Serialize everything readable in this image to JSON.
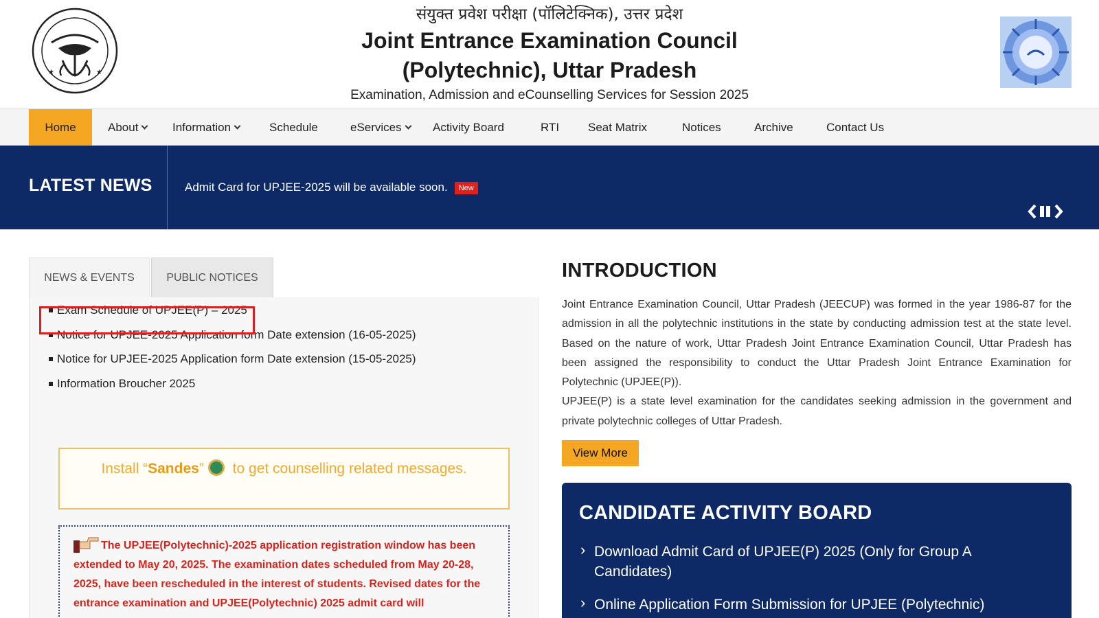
{
  "header": {
    "hindi_title": "संयुक्त प्रवेश परीक्षा (पॉलिटेक्निक), उत्तर प्रदेश",
    "title_line1": "Joint Entrance Examination Council",
    "title_line2": "(Polytechnic), Uttar Pradesh",
    "session": "Examination, Admission and eCounselling Services for Session 2025",
    "left_emblem": "uttar-pradesh-government-seal",
    "right_emblem": "jeec-parishad-logo"
  },
  "nav": {
    "items": [
      {
        "label": "Home",
        "active": true,
        "dropdown": false
      },
      {
        "label": "About",
        "active": false,
        "dropdown": true
      },
      {
        "label": "Information",
        "active": false,
        "dropdown": true
      },
      {
        "label": "Schedule",
        "active": false,
        "dropdown": false
      },
      {
        "label": "eServices",
        "active": false,
        "dropdown": true
      },
      {
        "label": "Activity Board",
        "active": false,
        "dropdown": false
      },
      {
        "label": "RTI",
        "active": false,
        "dropdown": false
      },
      {
        "label": "Seat Matrix",
        "active": false,
        "dropdown": false
      },
      {
        "label": "Notices",
        "active": false,
        "dropdown": false
      },
      {
        "label": "Archive",
        "active": false,
        "dropdown": false
      },
      {
        "label": "Contact Us",
        "active": false,
        "dropdown": false
      }
    ]
  },
  "latest_news": {
    "label": "LATEST NEWS",
    "text": "Admit Card for UPJEE-2025 will be available soon.",
    "badge": "New",
    "controls": [
      "chevron-left-icon",
      "pause-icon",
      "chevron-right-icon"
    ]
  },
  "tabs": {
    "news_events": "NEWS & EVENTS",
    "public_notices": "PUBLIC NOTICES"
  },
  "news_list": [
    "Exam Schedule of UPJEE(P) – 2025",
    "Notice for UPJEE-2025 Application form Date extension (16-05-2025)",
    "Notice for UPJEE-2025 Application form Date extension (15-05-2025)",
    "Information Broucher 2025"
  ],
  "sandes": {
    "prefix": "Install “",
    "app": "Sandes",
    "suffix_quote": "”",
    "rest": " to get counselling related messages."
  },
  "notice": {
    "text": "The UPJEE(Polytechnic)-2025 application registration window has been extended to May 20, 2025. The examination dates scheduled from May 20-28, 2025, have been rescheduled in the interest of students. Revised dates for the entrance examination and UPJEE(Polytechnic) 2025 admit card will"
  },
  "intro": {
    "title": "INTRODUCTION",
    "para1": "Joint Entrance Examination Council, Uttar Pradesh (JEECUP) was formed in the year 1986-87 for the admission in all the polytechnic institutions in the state by conducting admission test at the state level. Based on the nature of work, Uttar Pradesh Joint Entrance Examination Council, Uttar Pradesh has been assigned the responsibility to conduct the Uttar Pradesh Joint Entrance Examination for Polytechnic (UPJEE(P)).",
    "para2": "UPJEE(P) is a state level examination for the candidates seeking admission in the government and private polytechnic colleges of Uttar Pradesh.",
    "view_more": "View More"
  },
  "board": {
    "title": "CANDIDATE ACTIVITY BOARD",
    "items": [
      "Download Admit Card of UPJEE(P) 2025 (Only for Group A Candidates)",
      "Online Application Form Submission for UPJEE (Polytechnic)"
    ]
  },
  "colors": {
    "navy": "#0d2a66",
    "orange": "#f5a623",
    "red": "#e02020",
    "notice_red": "#d8241c"
  }
}
